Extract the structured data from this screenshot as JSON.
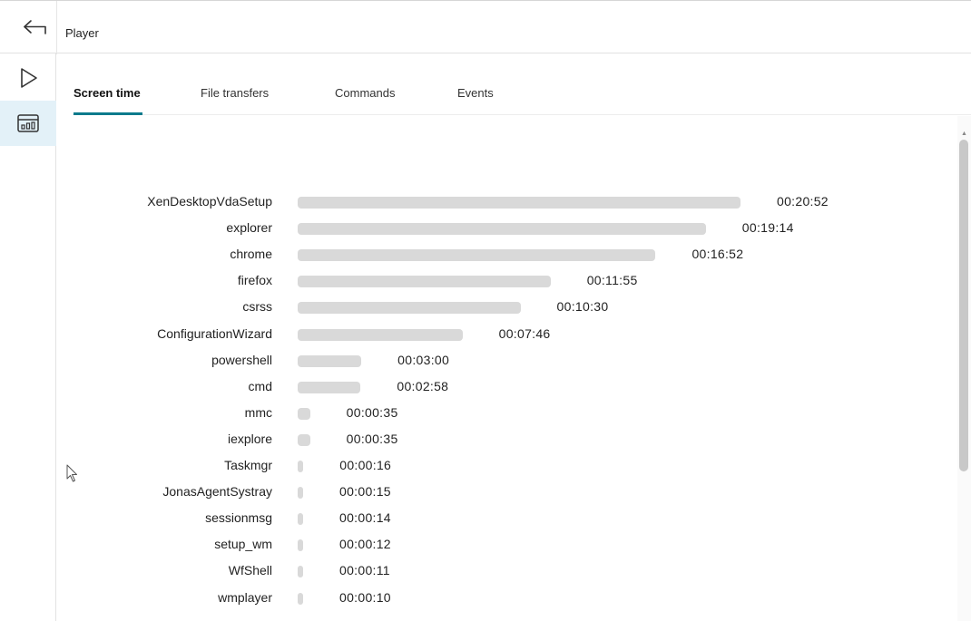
{
  "header": {
    "title": "Player",
    "back_icon": "back-arrow-icon"
  },
  "rail": {
    "items": [
      {
        "name": "play",
        "icon": "play-icon",
        "active": false
      },
      {
        "name": "statistics",
        "icon": "bar-chart-icon",
        "active": true
      }
    ]
  },
  "tabs": [
    {
      "label": "Screen time",
      "active": true
    },
    {
      "label": "File transfers",
      "active": false
    },
    {
      "label": "Commands",
      "active": false
    },
    {
      "label": "Events",
      "active": false
    }
  ],
  "colors": {
    "accent": "#0b7a8c",
    "bar": "#d9d9d9",
    "active_rail_bg": "#e3f1f8"
  },
  "chart_data": {
    "type": "bar",
    "orientation": "horizontal",
    "categories": [
      "XenDesktopVdaSetup",
      "explorer",
      "chrome",
      "firefox",
      "csrss",
      "ConfigurationWizard",
      "powershell",
      "cmd",
      "mmc",
      "iexplore",
      "Taskmgr",
      "JonasAgentSystray",
      "sessionmsg",
      "setup_wm",
      "WfShell",
      "wmplayer"
    ],
    "values": [
      1252,
      1154,
      1012,
      715,
      630,
      466,
      180,
      178,
      35,
      35,
      16,
      15,
      14,
      12,
      11,
      10
    ],
    "value_labels": [
      "00:20:52",
      "00:19:14",
      "00:16:52",
      "00:11:55",
      "00:10:30",
      "00:07:46",
      "00:03:00",
      "00:02:58",
      "00:00:35",
      "00:00:35",
      "00:00:16",
      "00:00:15",
      "00:00:14",
      "00:00:12",
      "00:00:11",
      "00:00:10"
    ],
    "value_unit": "seconds"
  }
}
